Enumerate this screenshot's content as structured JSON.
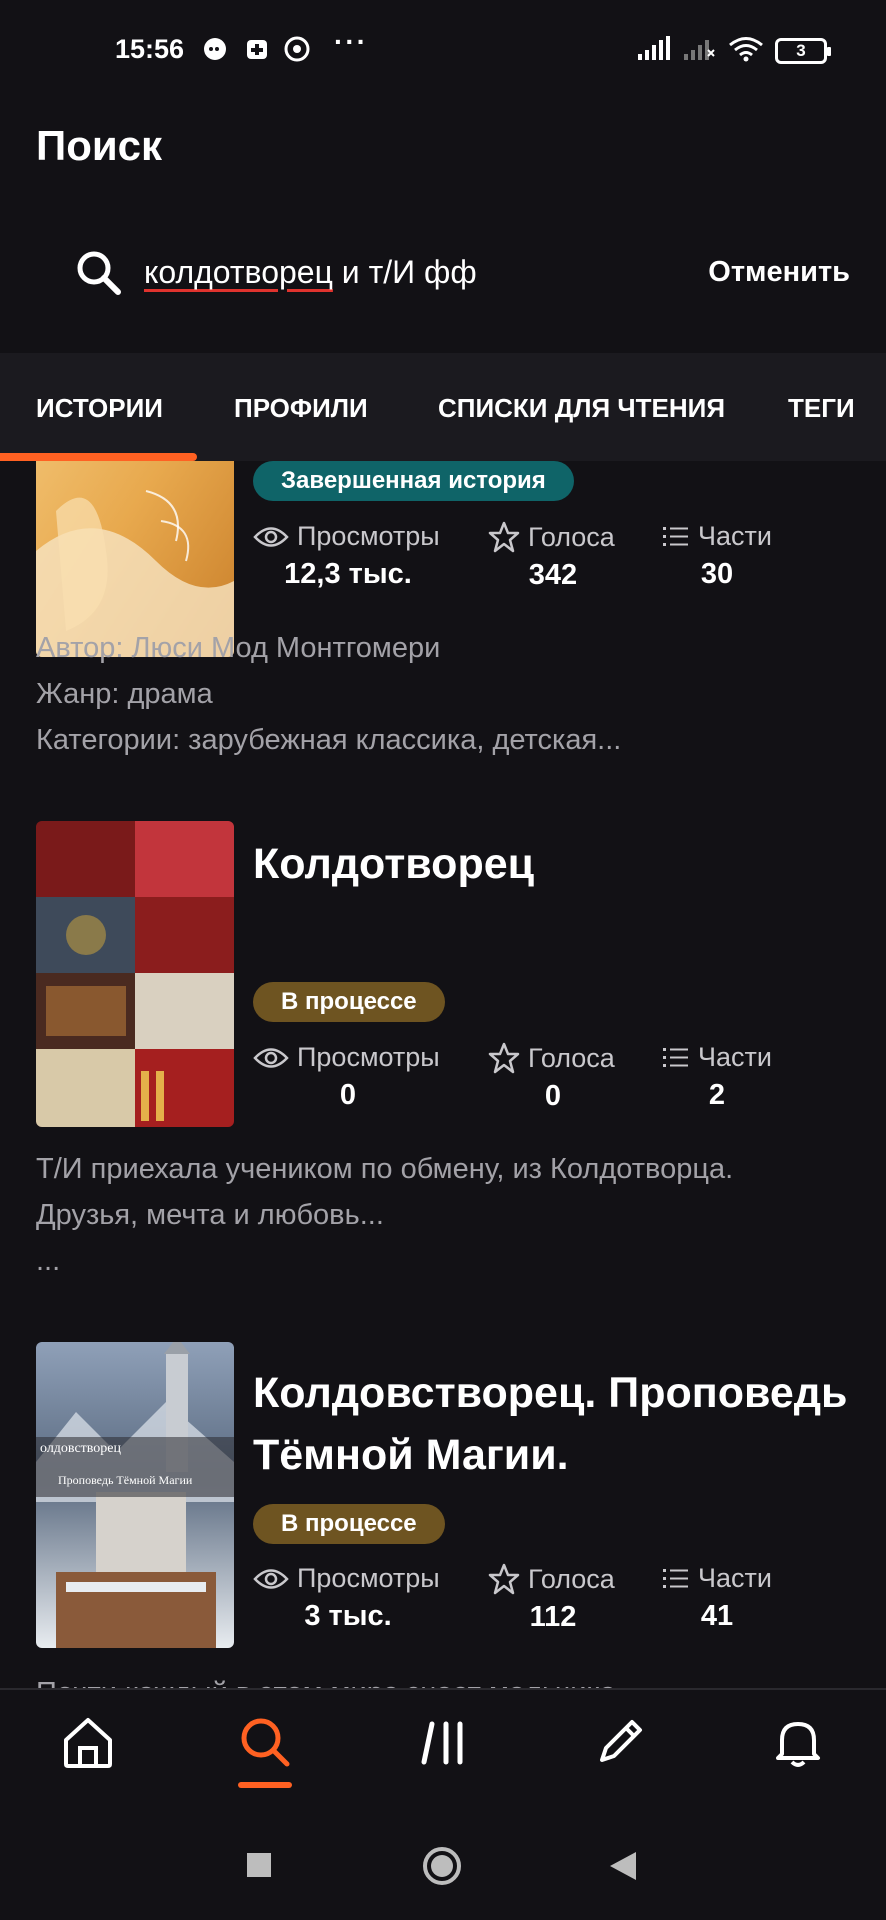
{
  "status_bar": {
    "time": "15:56",
    "battery": "3"
  },
  "header": {
    "title": "Поиск"
  },
  "search": {
    "query_underlined": "колдотворец",
    "query_rest": " и т/И фф",
    "cancel_label": "Отменить"
  },
  "tabs": [
    {
      "label": "ИСТОРИИ",
      "active": true
    },
    {
      "label": "ПРОФИЛИ"
    },
    {
      "label": "СПИСКИ ДЛЯ ЧТЕНИЯ"
    },
    {
      "label": "ТЕГИ"
    }
  ],
  "stat_labels": {
    "views": "Просмотры",
    "votes": "Голоса",
    "parts": "Части"
  },
  "stories": [
    {
      "status": "Завершенная история",
      "views": "12,3 тыс.",
      "votes": "342",
      "parts": "30",
      "desc": [
        "Автор: Люси Мод Монтгомери",
        "Жанр: драма",
        "Категории: зарубежная классика, детская..."
      ]
    },
    {
      "title": "Колдотворец",
      "status": "В процессе",
      "views": "0",
      "votes": "0",
      "parts": "2",
      "desc": [
        "Т/И приехала учеником по обмену, из Колдотворца.",
        "Друзья, мечта и любовь...",
        "..."
      ]
    },
    {
      "title_line1": "Колдовстворец. Проповедь",
      "title_line2": "Тёмной Магии.",
      "cover_text1": "олдовстворец",
      "cover_text2": "Проповедь Тёмной Магии",
      "status": "В процессе",
      "views": "3 тыс.",
      "votes": "112",
      "parts": "41",
      "desc": [
        "Почти каждый в этом мире знает мальчика"
      ]
    }
  ],
  "colors": {
    "accent": "#ff6122",
    "done_badge": "#0f6468",
    "progress_badge": "#6e5421",
    "background": "#121115"
  }
}
